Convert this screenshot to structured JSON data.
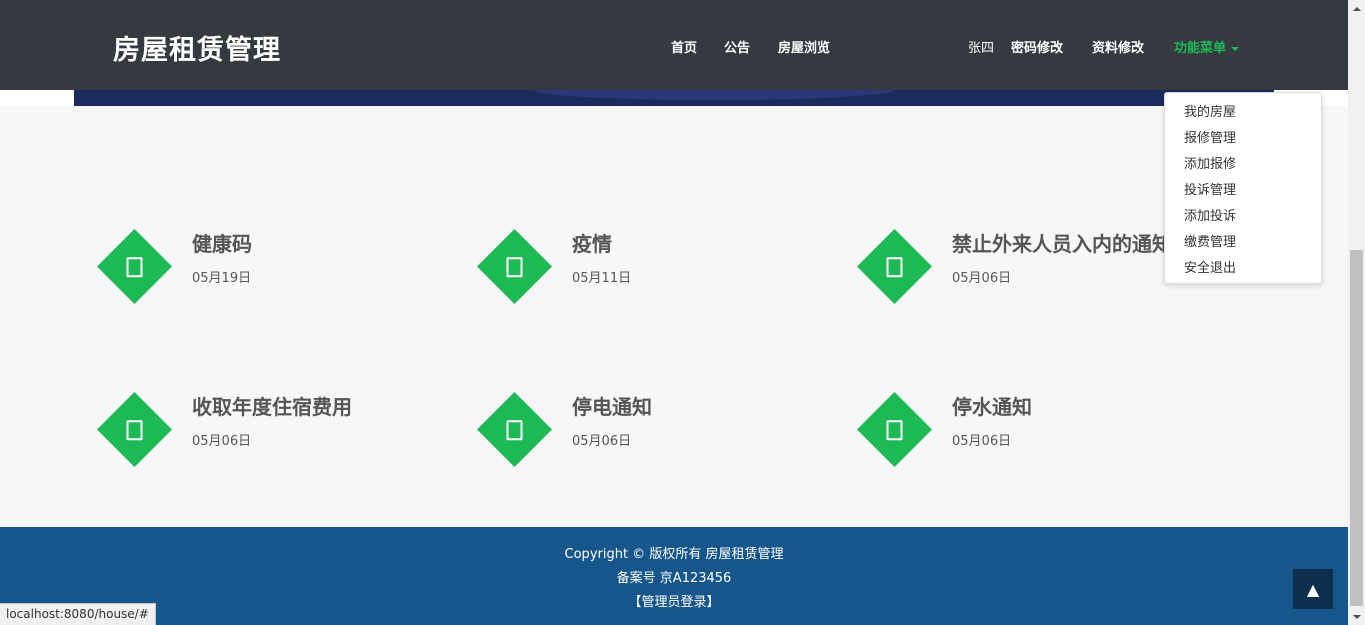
{
  "header": {
    "brand": "房屋租赁管理",
    "nav": [
      "首页",
      "公告",
      "房屋浏览"
    ],
    "user": "张四",
    "password_link": "密码修改",
    "profile_link": "资料修改",
    "menu_label": "功能菜单"
  },
  "dropdown": {
    "items": [
      "我的房屋",
      "报修管理",
      "添加报修",
      "投诉管理",
      "添加投诉",
      "缴费管理",
      "安全退出"
    ]
  },
  "notices": [
    {
      "title": "健康码",
      "date": "05月19日"
    },
    {
      "title": "疫情",
      "date": "05月11日"
    },
    {
      "title": "禁止外来人员入内的通知",
      "date": "05月06日"
    },
    {
      "title": "收取年度住宿费用",
      "date": "05月06日"
    },
    {
      "title": "停电通知",
      "date": "05月06日"
    },
    {
      "title": "停水通知",
      "date": "05月06日"
    }
  ],
  "footer": {
    "copyright": "Copyright © 版权所有 房屋租赁管理",
    "icp": "备案号 京A123456",
    "admin_login": "【管理员登录】"
  },
  "back_to_top": "▲",
  "status_url": "localhost:8080/house/#",
  "colors": {
    "accent": "#1db954",
    "navbar": "#343a40",
    "footer": "#16568a"
  }
}
